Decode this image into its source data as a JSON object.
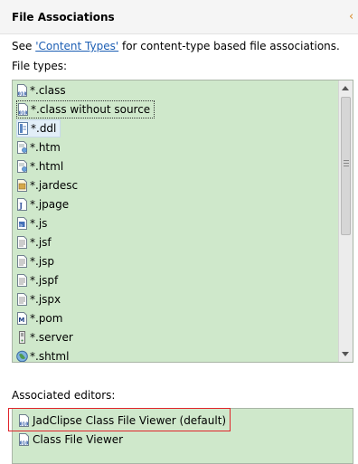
{
  "header": {
    "title": "File Associations"
  },
  "intro": {
    "prefix": "See ",
    "link": "'Content Types'",
    "suffix": " for content-type based file associations."
  },
  "file_types": {
    "label": "File types:",
    "items": [
      {
        "label": "*.class",
        "icon": "class-file-icon"
      },
      {
        "label": "*.class without source",
        "icon": "class-file-icon"
      },
      {
        "label": "*.ddl",
        "icon": "table-file-icon"
      },
      {
        "label": "*.htm",
        "icon": "html-file-icon"
      },
      {
        "label": "*.html",
        "icon": "html-file-icon"
      },
      {
        "label": "*.jardesc",
        "icon": "jar-file-icon"
      },
      {
        "label": "*.jpage",
        "icon": "java-page-icon"
      },
      {
        "label": "*.js",
        "icon": "js-file-icon"
      },
      {
        "label": "*.jsf",
        "icon": "text-file-icon"
      },
      {
        "label": "*.jsp",
        "icon": "text-file-icon"
      },
      {
        "label": "*.jspf",
        "icon": "text-file-icon"
      },
      {
        "label": "*.jspx",
        "icon": "text-file-icon"
      },
      {
        "label": "*.pom",
        "icon": "maven-file-icon"
      },
      {
        "label": "*.server",
        "icon": "server-file-icon"
      },
      {
        "label": "*.shtml",
        "icon": "globe-file-icon"
      }
    ]
  },
  "associated_editors": {
    "label": "Associated editors:",
    "items": [
      {
        "label": "JadClipse Class File Viewer (default)",
        "icon": "class-file-icon"
      },
      {
        "label": "Class File Viewer",
        "icon": "class-file-icon"
      }
    ]
  }
}
